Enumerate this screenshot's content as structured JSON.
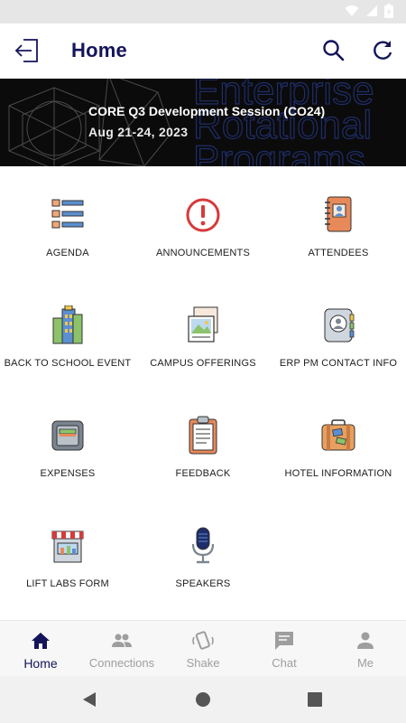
{
  "app_bar": {
    "title": "Home"
  },
  "banner": {
    "event_title": "CORE Q3 Development Session (CO24)",
    "event_dates": "Aug 21-24, 2023",
    "background_text": [
      "Enterprise",
      "Rotational",
      "Programs"
    ]
  },
  "tiles": [
    {
      "label": "AGENDA",
      "icon": "agenda-list-icon"
    },
    {
      "label": "ANNOUNCEMENTS",
      "icon": "alert-icon"
    },
    {
      "label": "ATTENDEES",
      "icon": "notebook-person-icon"
    },
    {
      "label": "BACK TO SCHOOL EVENT",
      "icon": "building-icon"
    },
    {
      "label": "CAMPUS OFFERINGS",
      "icon": "photo-stack-icon"
    },
    {
      "label": "ERP PM CONTACT INFO",
      "icon": "contact-book-icon"
    },
    {
      "label": "EXPENSES",
      "icon": "wallet-icon"
    },
    {
      "label": "FEEDBACK",
      "icon": "clipboard-icon"
    },
    {
      "label": "HOTEL INFORMATION",
      "icon": "suitcase-icon"
    },
    {
      "label": "LIFT LABS FORM",
      "icon": "storefront-icon"
    },
    {
      "label": "SPEAKERS",
      "icon": "microphone-icon"
    }
  ],
  "bottom_nav": {
    "items": [
      {
        "label": "Home",
        "icon": "home-icon",
        "active": true
      },
      {
        "label": "Connections",
        "icon": "people-icon",
        "active": false
      },
      {
        "label": "Shake",
        "icon": "shake-phone-icon",
        "active": false
      },
      {
        "label": "Chat",
        "icon": "chat-bubble-icon",
        "active": false
      },
      {
        "label": "Me",
        "icon": "person-icon",
        "active": false
      }
    ]
  },
  "colors": {
    "primary": "#14145a",
    "inactive": "#9e9e9e",
    "banner_bg": "#0b0b0b",
    "alert_red": "#d63a3a",
    "accent_orange": "#e8895a",
    "accent_blue": "#5b8fd0"
  }
}
